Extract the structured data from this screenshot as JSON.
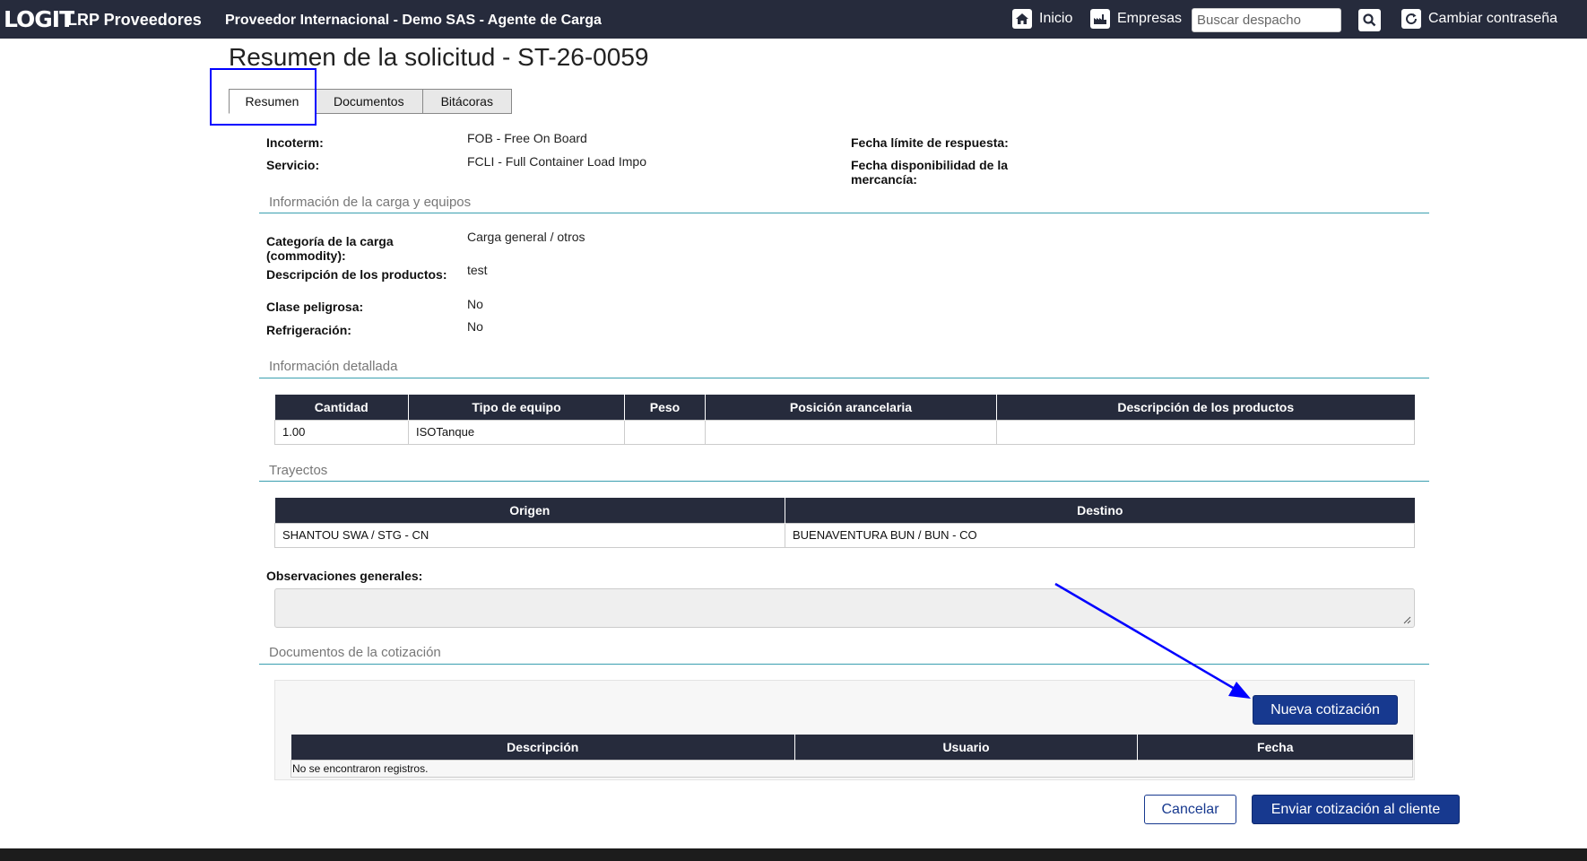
{
  "header": {
    "logo": "LOGIT",
    "app_title": "LRP Proveedores",
    "provider": "Proveedor Internacional - Demo SAS - Agente de Carga",
    "nav": {
      "home_label": "Inicio",
      "companies_label": "Empresas",
      "search_placeholder": "Buscar despacho",
      "change_password_label": "Cambiar contraseña"
    },
    "icons": {
      "home": "home-icon",
      "companies": "factory-icon",
      "search": "search-icon",
      "refresh": "refresh-icon"
    }
  },
  "page": {
    "title": "Resumen de la solicitud - ST-26-0059",
    "tabs": [
      {
        "label": "Resumen",
        "active": true
      },
      {
        "label": "Documentos",
        "active": false
      },
      {
        "label": "Bitácoras",
        "active": false
      }
    ]
  },
  "summary": {
    "incoterm_label": "Incoterm:",
    "incoterm_value": "FOB - Free On Board",
    "service_label": "Servicio:",
    "service_value": "FCLI - Full Container Load Impo",
    "deadline_label": "Fecha límite de respuesta:",
    "availability_label": "Fecha disponibilidad de la mercancía:"
  },
  "cargo": {
    "section_title": "Información de la carga y equipos",
    "commodity_label": "Categoría de la carga (commodity):",
    "commodity_value": "Carga general / otros",
    "description_label": "Descripción de los productos:",
    "description_value": "test",
    "dangerous_label": "Clase peligrosa:",
    "dangerous_value": "No",
    "refrigeration_label": "Refrigeración:",
    "refrigeration_value": "No"
  },
  "detail": {
    "section_title": "Información detallada",
    "columns": [
      "Cantidad",
      "Tipo de equipo",
      "Peso",
      "Posición arancelaria",
      "Descripción de los productos"
    ],
    "rows": [
      [
        "1.00",
        "ISOTanque",
        "",
        "",
        ""
      ]
    ]
  },
  "routes": {
    "section_title": "Trayectos",
    "columns": [
      "Origen",
      "Destino"
    ],
    "rows": [
      [
        "SHANTOU SWA / STG - CN",
        "BUENAVENTURA BUN / BUN - CO"
      ]
    ]
  },
  "observations": {
    "label": "Observaciones generales:",
    "value": ""
  },
  "quote_docs": {
    "section_title": "Documentos de la cotización",
    "new_button": "Nueva cotización",
    "columns": [
      "Descripción",
      "Usuario",
      "Fecha"
    ],
    "empty_message": "No se encontraron registros."
  },
  "actions": {
    "cancel": "Cancelar",
    "send": "Enviar cotización al cliente"
  },
  "colors": {
    "navbar": "#262b3c",
    "primary": "#17398f",
    "section_line": "#3a9fb0",
    "annotation": "#0000ff"
  }
}
